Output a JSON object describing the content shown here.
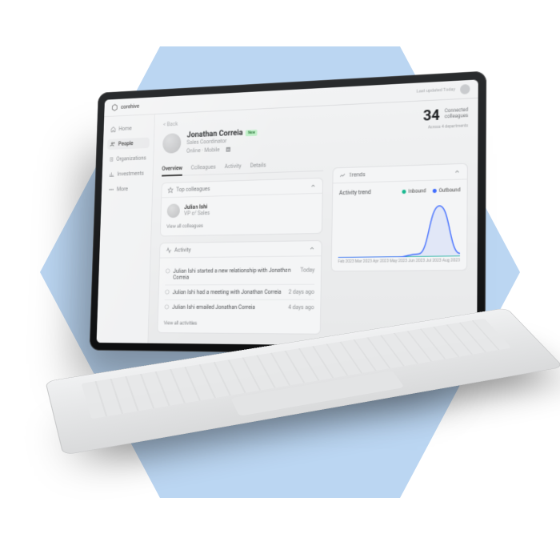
{
  "brand": "corehive",
  "topbar": {
    "updated": "Last updated Today"
  },
  "sidebar": {
    "items": [
      {
        "icon": "home",
        "label": "Home"
      },
      {
        "icon": "people",
        "label": "People"
      },
      {
        "icon": "org",
        "label": "Organizations"
      },
      {
        "icon": "invest",
        "label": "Investments"
      },
      {
        "icon": "more",
        "label": "More"
      }
    ],
    "activeIndex": 1
  },
  "breadcrumb": "< Back",
  "person": {
    "name": "Jonathan Correia",
    "badge": "New",
    "role": "Sales Coordinator",
    "status": "Online · Mobile"
  },
  "stat": {
    "value": "34",
    "label": "Connected\ncolleagues",
    "sub": "Across 4 departments"
  },
  "tabs": [
    "Overview",
    "Colleagues",
    "Activity",
    "Details"
  ],
  "activeTab": 0,
  "topColleagues": {
    "title": "Top colleagues",
    "items": [
      {
        "name": "Julian Ishi",
        "role": "VP of Sales"
      }
    ],
    "link": "View all colleagues"
  },
  "activity": {
    "title": "Activity",
    "rows": [
      {
        "text": "Julian Ishi started a new relationship with Jonathan Correia",
        "when": "Today"
      },
      {
        "text": "Julian Ishi had a meeting with Jonathan Correia",
        "when": "2 days ago"
      },
      {
        "text": "Julian Ishi emailed Jonathan Correia",
        "when": "4 days ago"
      }
    ],
    "link": "View all activities"
  },
  "trends": {
    "title": "Trends",
    "subtitle": "Activity trend",
    "legend": [
      {
        "label": "Inbound",
        "color": "#17b88f"
      },
      {
        "label": "Outbound",
        "color": "#3e6bff"
      }
    ]
  },
  "chart_data": {
    "type": "line",
    "title": "Activity trend",
    "xlabel": "",
    "ylabel": "",
    "categories": [
      "Feb 2023",
      "Mar 2023",
      "Apr 2023",
      "May 2023",
      "Jun 2023",
      "Jul 2023",
      "Aug 2023"
    ],
    "series": [
      {
        "name": "Inbound",
        "color": "#17b88f",
        "values": [
          0,
          0,
          0,
          0,
          0,
          0,
          0
        ]
      },
      {
        "name": "Outbound",
        "color": "#3e6bff",
        "values": [
          0,
          0,
          0,
          0,
          2,
          34,
          2
        ]
      }
    ],
    "ylim": [
      0,
      40
    ]
  }
}
